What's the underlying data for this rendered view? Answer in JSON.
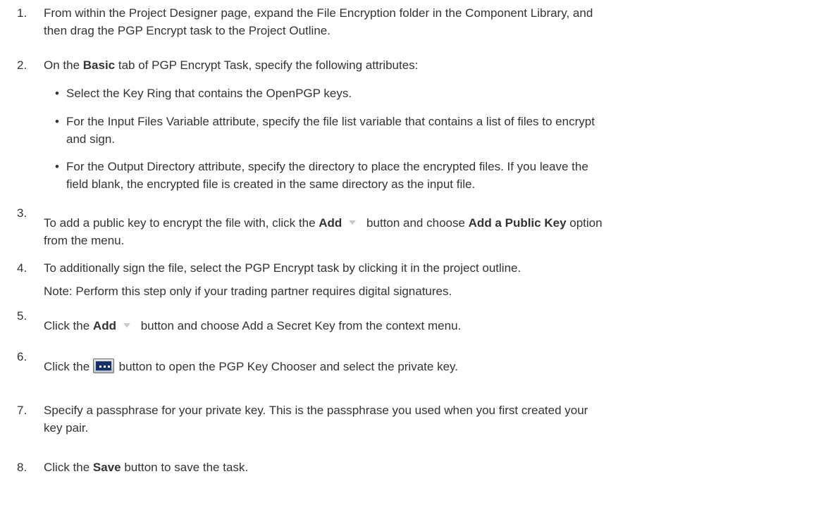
{
  "steps": [
    {
      "num": "1.",
      "l1": "From within the Project Designer page, expand the File Encryption folder in the Component Library, and",
      "l2": "then drag the PGP Encrypt task to the Project Outline."
    },
    {
      "num": "2.",
      "pre": "On the ",
      "bold": "Basic",
      "post": " tab of PGP Encrypt Task, specify the following attributes:",
      "bullets": [
        {
          "l1": "Select the Key Ring that contains the OpenPGP keys.",
          "l2": ""
        },
        {
          "l1": "For the Input Files Variable attribute, specify the file list variable that contains a list of files to encrypt",
          "l2": "and sign."
        },
        {
          "l1": "For the Output Directory attribute, specify the directory to place the encrypted files. If you leave the",
          "l2": "field blank, the encrypted file is created in the same directory as the input file."
        }
      ]
    },
    {
      "num": "3.",
      "pre": "To add a public key to encrypt the file with, click the ",
      "bold1": "Add",
      "mid": " button and choose ",
      "bold2": "Add a Public Key",
      "post": " option",
      "l2": "from the menu."
    },
    {
      "num": "4.",
      "l1": "To additionally sign the file, select the PGP Encrypt task by clicking it in the project outline.",
      "note": "Note: Perform this step only if your trading partner requires digital signatures."
    },
    {
      "num": "5.",
      "pre": "Click the ",
      "bold": "Add",
      "post": " button and choose Add a Secret Key from the context menu."
    },
    {
      "num": "6.",
      "pre": "Click the ",
      "post": " button to open the PGP Key Chooser and select the private key."
    },
    {
      "num": "7.",
      "l1": "Specify a passphrase for your private key.  This is the passphrase you used when you first created your",
      "l2": "key pair."
    },
    {
      "num": "8.",
      "pre": "Click the ",
      "bold": "Save",
      "post": " button to save the task."
    }
  ],
  "icons": {
    "caret": "chevron-down-icon",
    "chooser": "ellipsis-button-icon"
  }
}
